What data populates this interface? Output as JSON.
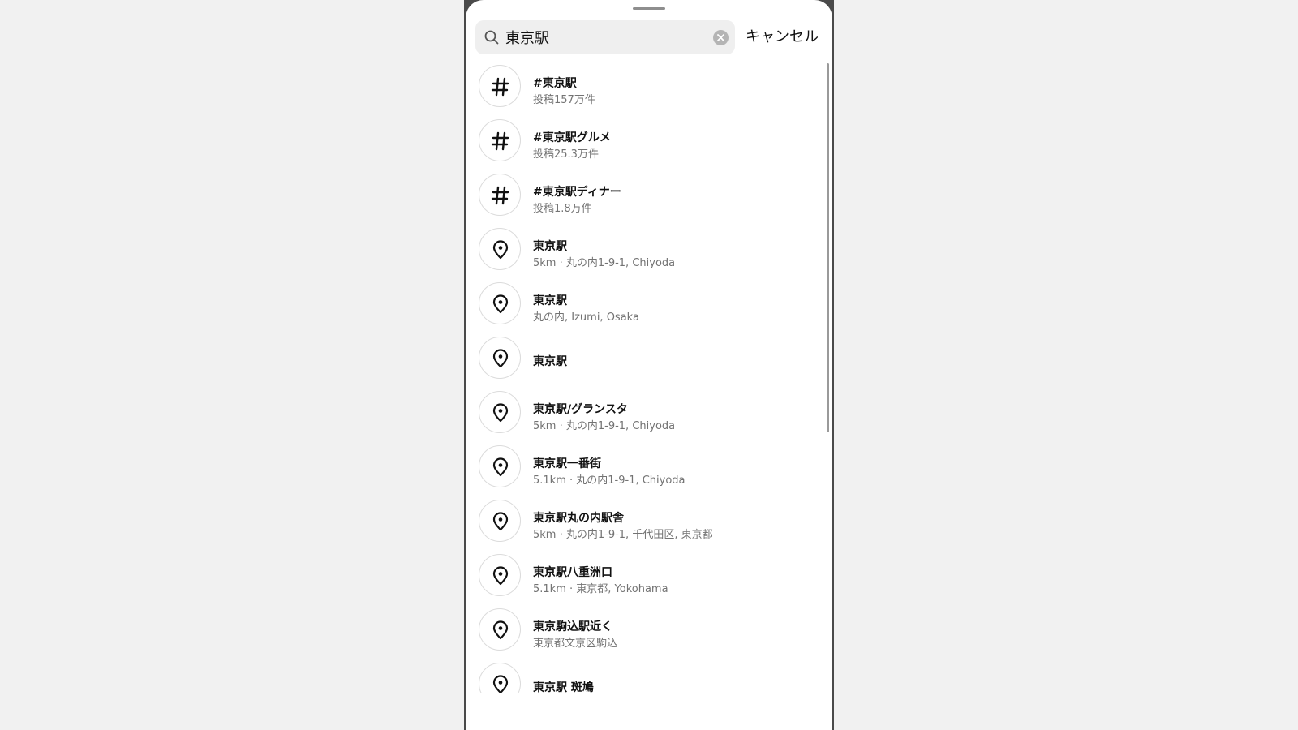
{
  "search": {
    "value": "東京駅",
    "cancel_label": "キャンセル",
    "clear_icon": "clear-icon",
    "search_icon": "search-icon"
  },
  "results": [
    {
      "type": "hashtag",
      "icon": "hashtag-icon",
      "title": "#東京駅",
      "subtitle": "投稿157万件"
    },
    {
      "type": "hashtag",
      "icon": "hashtag-icon",
      "title": "#東京駅グルメ",
      "subtitle": "投稿25.3万件"
    },
    {
      "type": "hashtag",
      "icon": "hashtag-icon",
      "title": "#東京駅ディナー",
      "subtitle": "投稿1.8万件"
    },
    {
      "type": "location",
      "icon": "location-pin-icon",
      "title": "東京駅",
      "subtitle": "5km · 丸の内1-9-1, Chiyoda"
    },
    {
      "type": "location",
      "icon": "location-pin-icon",
      "title": "東京駅",
      "subtitle": "丸の内, Izumi, Osaka"
    },
    {
      "type": "location",
      "icon": "location-pin-icon",
      "title": "東京駅",
      "subtitle": ""
    },
    {
      "type": "location",
      "icon": "location-pin-icon",
      "title": "東京駅/グランスタ",
      "subtitle": "5km · 丸の内1-9-1, Chiyoda"
    },
    {
      "type": "location",
      "icon": "location-pin-icon",
      "title": "東京駅一番街",
      "subtitle": "5.1km · 丸の内1-9-1, Chiyoda"
    },
    {
      "type": "location",
      "icon": "location-pin-icon",
      "title": "東京駅丸の内駅舎",
      "subtitle": "5km · 丸の内1-9-1, 千代田区, 東京都"
    },
    {
      "type": "location",
      "icon": "location-pin-icon",
      "title": "東京駅八重洲口",
      "subtitle": "5.1km · 東京都, Yokohama"
    },
    {
      "type": "location",
      "icon": "location-pin-icon",
      "title": "東京駒込駅近く",
      "subtitle": "東京都文京区駒込"
    },
    {
      "type": "location",
      "icon": "location-pin-icon",
      "title": "東京駅 斑鳩",
      "subtitle": ""
    }
  ],
  "colors": {
    "primary_text": "#111111",
    "secondary_text": "#737373",
    "search_bg": "#efefef"
  }
}
